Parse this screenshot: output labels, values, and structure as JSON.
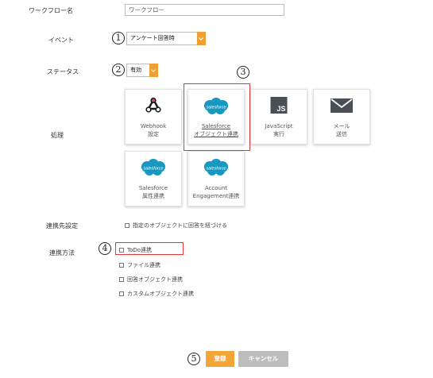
{
  "workflow_name": {
    "label": "ワークフロー名",
    "value": "ワークフロー"
  },
  "event": {
    "label": "イベント",
    "marker": "1",
    "selected": "アンケート回答時"
  },
  "status": {
    "label": "ステータス",
    "marker": "2",
    "selected": "有効"
  },
  "processing": {
    "label": "処理",
    "marker": "3",
    "cards": [
      {
        "line1": "Webhook",
        "line2": "設定",
        "icon": "webhook-icon"
      },
      {
        "line1": "Salesforce",
        "line2": "オブジェクト連携",
        "icon": "salesforce-icon",
        "logo_text": "salesforce",
        "selected": true
      },
      {
        "line1": "JavaScript",
        "line2": "実行",
        "icon": "javascript-icon",
        "logo_text": "JS"
      },
      {
        "line1": "メール",
        "line2": "送信",
        "icon": "mail-icon"
      },
      {
        "line1": "Salesforce",
        "line2": "属性連携",
        "icon": "salesforce-icon",
        "logo_text": "salesforce"
      },
      {
        "line1": "Account",
        "line2": "Engagement連携",
        "icon": "salesforce-icon",
        "logo_text": "salesforce"
      }
    ]
  },
  "link_destination": {
    "label": "連携先設定",
    "option": "指定のオブジェクトに回答を紐づける"
  },
  "link_method": {
    "label": "連携方法",
    "marker": "4",
    "options": [
      "ToDo連携",
      "ファイル連携",
      "回答オブジェクト連携",
      "カスタムオブジェクト連携"
    ]
  },
  "footer": {
    "marker": "5",
    "register": "登録",
    "cancel": "キャンセル"
  },
  "colors": {
    "accent": "#f3a536",
    "highlight": "#e53935",
    "salesforce_blue": "#1798c1",
    "js_dark": "#4a4f55",
    "mail_dark": "#4a4f55"
  }
}
